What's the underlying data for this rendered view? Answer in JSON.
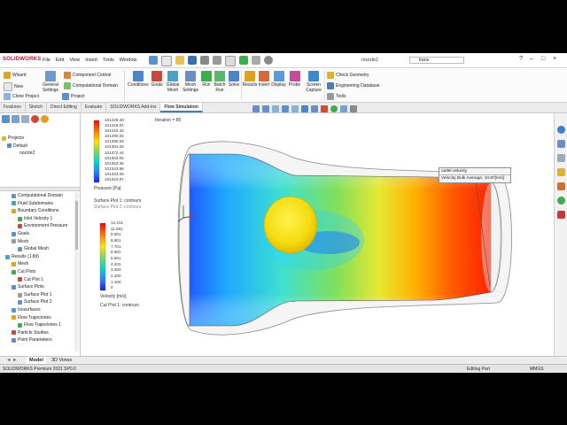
{
  "app": {
    "brand": "SOLIDWORKS",
    "menu": [
      "File",
      "Edit",
      "View",
      "Insert",
      "Tools",
      "Window"
    ],
    "document_title": "nozzle2",
    "search_value": "trans"
  },
  "ribbon": {
    "col1": [
      "Wizard",
      "New",
      "Clone Project"
    ],
    "col2": [
      "General Settings",
      "Project"
    ],
    "col3": [
      "Component Control",
      "Computational Domain"
    ],
    "big_buttons": [
      "Conditions",
      "Goals",
      "Global Mesh",
      "Mesh Settings",
      "Run",
      "Batch Run",
      "Solve",
      "Results",
      "Insert",
      "Display",
      "Probe",
      "Screen Capture"
    ],
    "right": [
      "Check Geometry",
      "Engineering Database",
      "Tools"
    ]
  },
  "tabs": [
    "Features",
    "Sketch",
    "Direct Editing",
    "Evaluate",
    "SOLIDWORKS Add-Ins",
    "Flow Simulation"
  ],
  "active_tab": "Flow Simulation",
  "tree_top": [
    "Projects",
    "Default",
    "nozzle2"
  ],
  "tree": [
    {
      "label": "Computational Domain",
      "indent": 1
    },
    {
      "label": "Fluid Subdomains",
      "indent": 1
    },
    {
      "label": "Boundary Conditions",
      "indent": 1
    },
    {
      "label": "Inlet Velocity 1",
      "indent": 2
    },
    {
      "label": "Environment Pressure",
      "indent": 2
    },
    {
      "label": "Goals",
      "indent": 1
    },
    {
      "label": "Mesh",
      "indent": 1
    },
    {
      "label": "Global Mesh",
      "indent": 2
    },
    {
      "label": "Results (1.fld)",
      "indent": 0
    },
    {
      "label": "Mesh",
      "indent": 1
    },
    {
      "label": "Cut Plots",
      "indent": 1
    },
    {
      "label": "Cut Plot 1",
      "indent": 2
    },
    {
      "label": "Surface Plots",
      "indent": 1
    },
    {
      "label": "Surface Plot 1",
      "indent": 2
    },
    {
      "label": "Surface Plot 2",
      "indent": 2
    },
    {
      "label": "Isosurfaces",
      "indent": 1
    },
    {
      "label": "Flow Trajectories",
      "indent": 1
    },
    {
      "label": "Flow Trajectories 1",
      "indent": 2
    },
    {
      "label": "Particle Studies",
      "indent": 1
    },
    {
      "label": "Point Parameters",
      "indent": 1
    }
  ],
  "viewport": {
    "iteration": "Iteration = 85",
    "pressure_legend": {
      "values": [
        "101429.40",
        "101419.01",
        "101410.42",
        "101400.02",
        "101390.63",
        "101381.03",
        "101372.44",
        "101362.05",
        "101353.45",
        "101343.96",
        "101334.46",
        "101324.97"
      ],
      "label": "Pressure [Pa]",
      "subtitle1": "Surface Plot 1: contours",
      "subtitle2": "Surface Plot 2: contours"
    },
    "velocity_legend": {
      "values": [
        "12.101",
        "11.001",
        "9.901",
        "8.801",
        "7.701",
        "6.601",
        "5.501",
        "4.401",
        "3.300",
        "2.200",
        "1.100",
        "0"
      ],
      "label": "Velocity [m/s]",
      "subtitle": "Cut Plot 1: contours"
    },
    "callout_title": "outlet velocity",
    "callout_value": "Velocity Bulk Average: 10.87[m/s]"
  },
  "bottom_tabs": [
    "Model",
    "3D Views"
  ],
  "status": {
    "left": "SOLIDWORKS Premium 2021 SP0.0",
    "mid": "Editing Part",
    "units": "MMGS"
  },
  "colors": {
    "accent": "#3b7dc4",
    "brand": "#c8102e"
  }
}
